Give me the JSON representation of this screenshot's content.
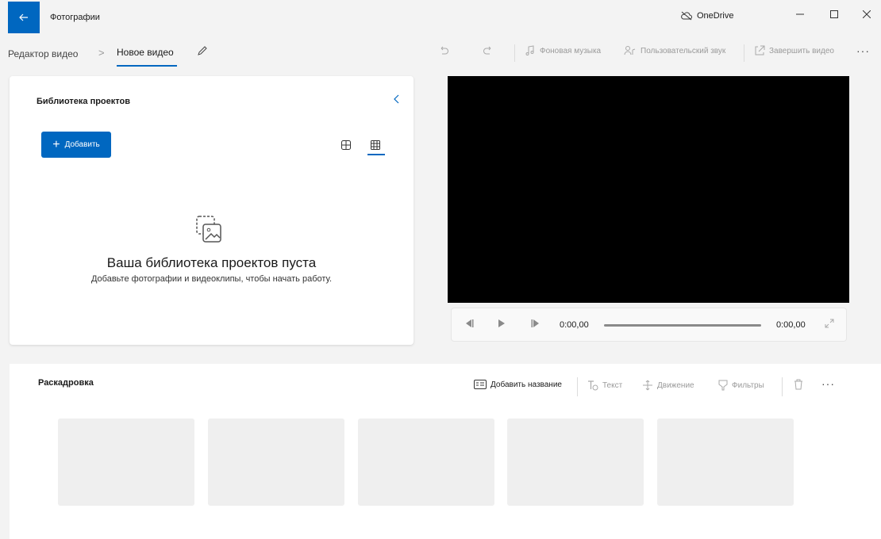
{
  "titlebar": {
    "app_title": "Фотографии",
    "onedrive_label": "OneDrive"
  },
  "toolbar": {
    "breadcrumb_parent": "Редактор видео",
    "breadcrumb_separator": ">",
    "breadcrumb_current": "Новое видео",
    "background_music": "Фоновая музыка",
    "custom_audio": "Пользовательский звук",
    "finish_video": "Завершить видео",
    "more": "···"
  },
  "library": {
    "title": "Библиотека проектов",
    "add_button": "Добавить",
    "empty_title": "Ваша библиотека проектов пуста",
    "empty_subtitle": "Добавьте фотографии и видеоклипы, чтобы начать работу."
  },
  "player": {
    "current_time": "0:00,00",
    "total_time": "0:00,00",
    "progress": 0
  },
  "storyboard": {
    "title": "Раскадровка",
    "add_title": "Добавить название",
    "text": "Текст",
    "motion": "Движение",
    "filters": "Фильтры",
    "more": "···"
  },
  "colors": {
    "accent": "#0067c0",
    "background": "#f3f3f3",
    "preview": "#000000"
  }
}
